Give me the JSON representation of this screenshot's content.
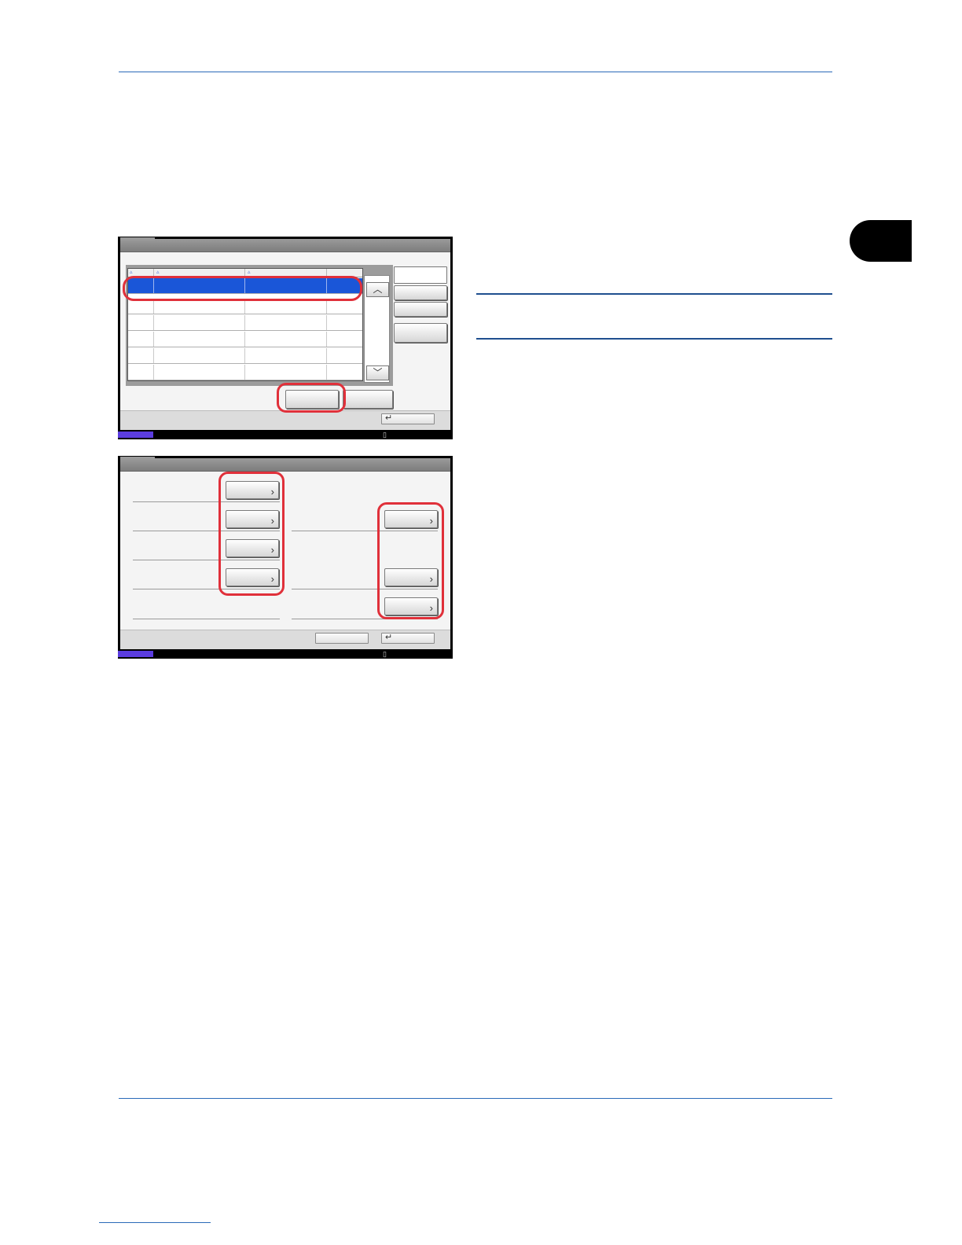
{
  "page": {
    "accent_color": "#2a6ab8",
    "highlight_color": "#e0303a",
    "selection_color": "#1a56d8",
    "status_color": "#5b3de0"
  },
  "screen1": {
    "scroll_up_icon": "chevron-up-icon",
    "scroll_down_icon": "chevron-down-icon",
    "sort_marker": "▵",
    "enter_glyph": "↵",
    "status_glyph": "▯"
  },
  "screen2": {
    "chevron_glyph": "›",
    "enter_glyph": "↵",
    "status_glyph": "▯"
  }
}
